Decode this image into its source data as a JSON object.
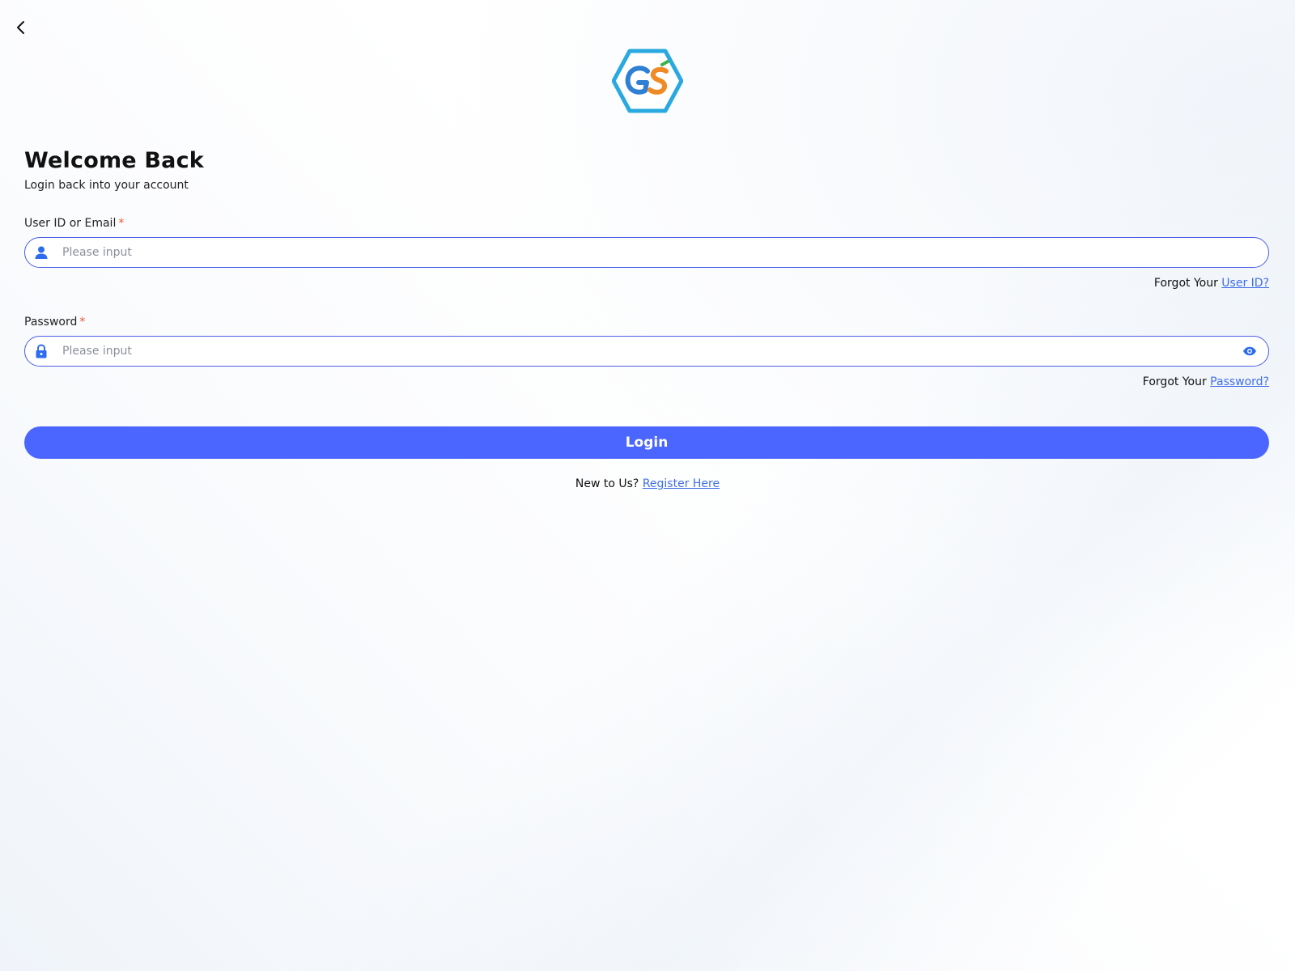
{
  "header": {
    "back_icon": "chevron-left-icon",
    "logo_text": "GS"
  },
  "intro": {
    "title": "Welcome Back",
    "subtitle": "Login back into your account"
  },
  "user_field": {
    "label": "User ID or Email",
    "required_mark": "*",
    "placeholder": "Please input",
    "value": "",
    "icon": "user-icon",
    "forgot_prefix": "Forgot Your",
    "forgot_link": "User ID?"
  },
  "password_field": {
    "label": "Password",
    "required_mark": "*",
    "placeholder": "Please input",
    "value": "",
    "icon": "lock-icon",
    "toggle_icon": "eye-icon",
    "forgot_prefix": "Forgot Your",
    "forgot_link": "Password?"
  },
  "login_button": {
    "label": "Login"
  },
  "register": {
    "prefix": "New to Us?",
    "link": "Register Here"
  },
  "colors": {
    "accent": "#4a66ff",
    "link": "#3f6ee6",
    "required": "#e8572f",
    "input_border": "#4a5fe6",
    "icon": "#2d6cf0",
    "logo_hex": "#2aa9e0"
  }
}
